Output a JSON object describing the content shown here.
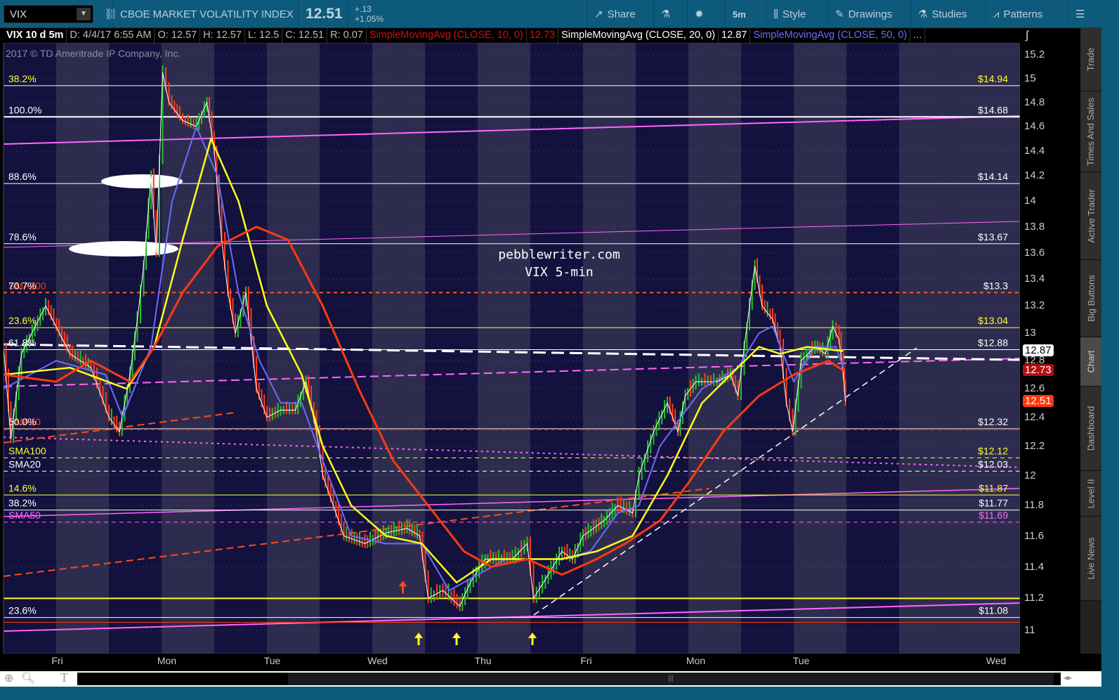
{
  "toolbar": {
    "symbol": "VIX",
    "description": "CBOE MARKET VOLATILITY INDEX",
    "last": "12.51",
    "change": "+.13",
    "change_pct": "+1.05%",
    "share": "Share",
    "timeframe": "5m",
    "style": "Style",
    "drawings": "Drawings",
    "studies": "Studies",
    "patterns": "Patterns"
  },
  "infobar": {
    "title": "VIX 10 d 5m",
    "date": "D: 4/4/17 6:55 AM",
    "open": "O: 12.57",
    "high": "H: 12.57",
    "low": "L: 12.5",
    "close": "C: 12.51",
    "range": "R: 0.07",
    "sma10": "SimpleMovingAvg (CLOSE, 10, 0)",
    "sma10_val": "12.73",
    "sma20": "SimpleMovingAvg (CLOSE, 20, 0)",
    "sma20_val": "12.87",
    "sma50": "SimpleMovingAvg (CLOSE, 50, 0)",
    "more": "..."
  },
  "copyright": "2017 © TD Ameritrade IP Company, Inc.",
  "watermark": [
    "pebblewriter.com",
    "VIX 5-min"
  ],
  "sidebar": [
    "Trade",
    "Times And Sales",
    "Active Trader",
    "Big Buttons",
    "Chart",
    "Dashboard",
    "Level II",
    "Live News"
  ],
  "colors": {
    "bg_dark": "#13113d",
    "bg_light": "#2e2c4e",
    "toolbar": "#0e5a7c",
    "up": "#22c02a",
    "down": "#ff3b1a",
    "sma_red": "#ff3a10",
    "sma_yellow": "#ffff1a",
    "sma_blue": "#6b6bff",
    "magenta": "#ff66ff"
  },
  "chart_data": {
    "type": "line",
    "title": "VIX 10 d 5m",
    "xlabel": "",
    "ylabel": "",
    "x_unit": "days from left edge",
    "xlim": [
      0,
      9.65
    ],
    "ylim": [
      10.95,
      15.3
    ],
    "y_scale": "log",
    "y_ticks": [
      "15.2",
      "15",
      "14.8",
      "14.6",
      "14.4",
      "14.2",
      "14",
      "13.8",
      "13.6",
      "13.4",
      "13.2",
      "13",
      "12.8",
      "12.6",
      "12.4",
      "12.2",
      "12",
      "11.8",
      "11.6",
      "11.4",
      "11.2",
      "11"
    ],
    "x_ticks": [
      {
        "label": "Fri",
        "x": 0.51
      },
      {
        "label": "Mon",
        "x": 1.55
      },
      {
        "label": "Tue",
        "x": 2.55
      },
      {
        "label": "Wed",
        "x": 3.55
      },
      {
        "label": "Thu",
        "x": 4.55
      },
      {
        "label": "Fri",
        "x": 5.53
      },
      {
        "label": "Mon",
        "x": 6.57
      },
      {
        "label": "Tue",
        "x": 7.57
      },
      {
        "label": "Wed",
        "x": 9.42
      }
    ],
    "price": [
      [
        0,
        12.9
      ],
      [
        0.07,
        12.25
      ],
      [
        0.17,
        12.85
      ],
      [
        0.4,
        13.2
      ],
      [
        0.63,
        12.85
      ],
      [
        0.83,
        12.75
      ],
      [
        1,
        12.4
      ],
      [
        1.1,
        12.3
      ],
      [
        1.2,
        12.7
      ],
      [
        1.27,
        13.1
      ],
      [
        1.33,
        13.5
      ],
      [
        1.4,
        14.2
      ],
      [
        1.45,
        13.6
      ],
      [
        1.51,
        15.05
      ],
      [
        1.57,
        14.8
      ],
      [
        1.7,
        14.65
      ],
      [
        1.83,
        14.6
      ],
      [
        1.93,
        14.8
      ],
      [
        2,
        14.4
      ],
      [
        2.07,
        13.7
      ],
      [
        2.13,
        13.3
      ],
      [
        2.2,
        13.0
      ],
      [
        2.3,
        13.3
      ],
      [
        2.4,
        12.6
      ],
      [
        2.5,
        12.4
      ],
      [
        2.63,
        12.45
      ],
      [
        2.77,
        12.45
      ],
      [
        2.87,
        12.65
      ],
      [
        2.97,
        12.3
      ],
      [
        3.03,
        12.0
      ],
      [
        3.13,
        11.8
      ],
      [
        3.23,
        11.6
      ],
      [
        3.43,
        11.55
      ],
      [
        3.63,
        11.62
      ],
      [
        3.83,
        11.65
      ],
      [
        3.95,
        11.6
      ],
      [
        4.03,
        11.2
      ],
      [
        4.17,
        11.25
      ],
      [
        4.33,
        11.15
      ],
      [
        4.43,
        11.3
      ],
      [
        4.57,
        11.45
      ],
      [
        4.83,
        11.45
      ],
      [
        4.97,
        11.55
      ],
      [
        5.03,
        11.2
      ],
      [
        5.17,
        11.35
      ],
      [
        5.3,
        11.5
      ],
      [
        5.4,
        11.45
      ],
      [
        5.5,
        11.6
      ],
      [
        5.7,
        11.7
      ],
      [
        5.83,
        11.8
      ],
      [
        5.97,
        11.75
      ],
      [
        6.03,
        12.0
      ],
      [
        6.17,
        12.3
      ],
      [
        6.3,
        12.5
      ],
      [
        6.4,
        12.3
      ],
      [
        6.47,
        12.55
      ],
      [
        6.57,
        12.65
      ],
      [
        6.77,
        12.65
      ],
      [
        6.9,
        12.7
      ],
      [
        6.97,
        12.55
      ],
      [
        7.03,
        12.9
      ],
      [
        7.13,
        13.5
      ],
      [
        7.2,
        13.2
      ],
      [
        7.3,
        13.1
      ],
      [
        7.37,
        12.9
      ],
      [
        7.43,
        12.5
      ],
      [
        7.49,
        12.3
      ],
      [
        7.57,
        12.8
      ],
      [
        7.7,
        12.9
      ],
      [
        7.8,
        12.85
      ],
      [
        7.87,
        13.05
      ],
      [
        7.93,
        12.95
      ],
      [
        7.97,
        12.7
      ],
      [
        7.99,
        12.51
      ]
    ],
    "series": [
      {
        "name": "SimpleMovingAvg (CLOSE, 50, 0)",
        "color": "#ff3a10",
        "values": [
          [
            0,
            12.7
          ],
          [
            0.5,
            12.65
          ],
          [
            0.83,
            12.8
          ],
          [
            1.2,
            12.65
          ],
          [
            1.43,
            12.9
          ],
          [
            1.7,
            13.3
          ],
          [
            2.03,
            13.65
          ],
          [
            2.4,
            13.8
          ],
          [
            2.7,
            13.7
          ],
          [
            3.03,
            13.2
          ],
          [
            3.37,
            12.6
          ],
          [
            3.7,
            12.1
          ],
          [
            4.03,
            11.8
          ],
          [
            4.37,
            11.5
          ],
          [
            4.63,
            11.4
          ],
          [
            4.97,
            11.45
          ],
          [
            5.3,
            11.35
          ],
          [
            5.63,
            11.45
          ],
          [
            5.9,
            11.55
          ],
          [
            6.23,
            11.7
          ],
          [
            6.5,
            11.95
          ],
          [
            6.83,
            12.3
          ],
          [
            7.17,
            12.55
          ],
          [
            7.5,
            12.7
          ],
          [
            7.83,
            12.8
          ],
          [
            7.97,
            12.73
          ]
        ]
      },
      {
        "name": "SimpleMovingAvg (CLOSE, 20, 0)",
        "color": "#ffff1a",
        "values": [
          [
            0,
            12.7
          ],
          [
            0.63,
            12.75
          ],
          [
            1.17,
            12.6
          ],
          [
            1.43,
            12.9
          ],
          [
            1.7,
            13.7
          ],
          [
            1.97,
            14.5
          ],
          [
            2.23,
            14.0
          ],
          [
            2.5,
            13.2
          ],
          [
            2.83,
            12.7
          ],
          [
            3.03,
            12.2
          ],
          [
            3.3,
            11.8
          ],
          [
            3.63,
            11.6
          ],
          [
            3.97,
            11.55
          ],
          [
            4.3,
            11.3
          ],
          [
            4.63,
            11.45
          ],
          [
            4.97,
            11.45
          ],
          [
            5.3,
            11.45
          ],
          [
            5.63,
            11.5
          ],
          [
            5.97,
            11.6
          ],
          [
            6.3,
            12.0
          ],
          [
            6.63,
            12.5
          ],
          [
            6.9,
            12.7
          ],
          [
            7.17,
            12.9
          ],
          [
            7.37,
            12.85
          ],
          [
            7.63,
            12.9
          ],
          [
            7.97,
            12.87
          ]
        ]
      },
      {
        "name": "SimpleMovingAvg (CLOSE, 10, 0)",
        "color": "#6b6bff",
        "values": [
          [
            0,
            12.6
          ],
          [
            0.5,
            12.8
          ],
          [
            0.97,
            12.7
          ],
          [
            1.13,
            12.4
          ],
          [
            1.4,
            12.9
          ],
          [
            1.6,
            14.0
          ],
          [
            1.83,
            14.6
          ],
          [
            2.03,
            14.2
          ],
          [
            2.23,
            13.3
          ],
          [
            2.43,
            12.8
          ],
          [
            2.63,
            12.5
          ],
          [
            2.83,
            12.5
          ],
          [
            3.03,
            12.1
          ],
          [
            3.3,
            11.6
          ],
          [
            3.63,
            11.55
          ],
          [
            3.97,
            11.55
          ],
          [
            4.23,
            11.25
          ],
          [
            4.5,
            11.35
          ],
          [
            4.77,
            11.45
          ],
          [
            5.03,
            11.45
          ],
          [
            5.3,
            11.45
          ],
          [
            5.57,
            11.5
          ],
          [
            5.83,
            11.75
          ],
          [
            6.03,
            11.8
          ],
          [
            6.23,
            12.2
          ],
          [
            6.43,
            12.4
          ],
          [
            6.63,
            12.6
          ],
          [
            6.97,
            12.75
          ],
          [
            7.17,
            13.0
          ],
          [
            7.3,
            13.05
          ],
          [
            7.5,
            12.65
          ],
          [
            7.7,
            12.9
          ],
          [
            7.9,
            12.9
          ],
          [
            7.97,
            12.75
          ]
        ]
      }
    ],
    "levels": [
      {
        "value": 14.94,
        "left": "38.2%",
        "right": "$14.94",
        "line": "#ffffff",
        "label": "#ffff33",
        "style": "solid"
      },
      {
        "value": 14.68,
        "left": "100.0%",
        "right": "$14.68",
        "line": "#ffffff",
        "label": "#ffffff",
        "style": "thick"
      },
      {
        "value": 14.14,
        "left": "88.6%",
        "right": "$14.14",
        "line": "#ffffff",
        "label": "#ffffff",
        "style": "solid"
      },
      {
        "value": 13.67,
        "left": "78.6%",
        "right": "$13.67",
        "line": "#ffffff",
        "label": "#ffffff",
        "style": "solid"
      },
      {
        "value": 13.3,
        "left": "70.7%",
        "right": "$13.3",
        "line": "#ff5a1a",
        "label": "#ffffff",
        "style": "dotted",
        "ghost": "SMA200"
      },
      {
        "value": 13.04,
        "left": "23.6%",
        "right": "$13.04",
        "line": "#ffff33",
        "label": "#ffff33",
        "style": "solid"
      },
      {
        "value": 12.88,
        "left": "61.8%",
        "right": "$12.88",
        "line": "#ffffff",
        "label": "#ffffff",
        "style": "solid"
      },
      {
        "value": 12.32,
        "left": "50.0%",
        "right": "$12.32",
        "line": "#ffffff",
        "label": "#ffffff",
        "style": "solid",
        "ghost": "SMA10"
      },
      {
        "value": 12.12,
        "left": "SMA100",
        "right": "$12.12",
        "line": "#ffff33",
        "label": "#ffff33",
        "style": "dashed"
      },
      {
        "value": 12.03,
        "left": "SMA20",
        "right": "$12.03",
        "line": "#ffffff",
        "label": "#ffffff",
        "style": "dashed"
      },
      {
        "value": 11.87,
        "left": "14.6%",
        "right": "$11.87",
        "line": "#ffff33",
        "label": "#ffff33",
        "style": "solid"
      },
      {
        "value": 11.77,
        "left": "38.2%",
        "right": "$11.77",
        "line": "#ffffff",
        "label": "#ffffff",
        "style": "solid"
      },
      {
        "value": 11.69,
        "left": "SMA50",
        "right": "$11.69",
        "line": "#ff66ff",
        "label": "#ff66ff",
        "style": "dashed"
      },
      {
        "value": 11.08,
        "left": "23.6%",
        "right": "$11.08",
        "line": "#ffffff",
        "label": "#ffffff",
        "style": "solid"
      }
    ],
    "badges": [
      {
        "value": 12.87,
        "text": "12.87",
        "bg": "#ffffff",
        "fg": "#000000"
      },
      {
        "value": 12.73,
        "text": "12.73",
        "bg": "#b30f0f",
        "fg": "#ffffff"
      },
      {
        "value": 12.51,
        "text": "12.51",
        "bg": "#ff3a10",
        "fg": "#ffffff"
      }
    ],
    "arrows": [
      {
        "x": 3.79,
        "y": 11.32,
        "color": "#ff4a1a"
      },
      {
        "x": 3.94,
        "y": 10.98,
        "color": "#ffff1a"
      },
      {
        "x": 4.3,
        "y": 10.98,
        "color": "#ffff1a"
      },
      {
        "x": 5.02,
        "y": 10.98,
        "color": "#ffff1a"
      }
    ]
  }
}
